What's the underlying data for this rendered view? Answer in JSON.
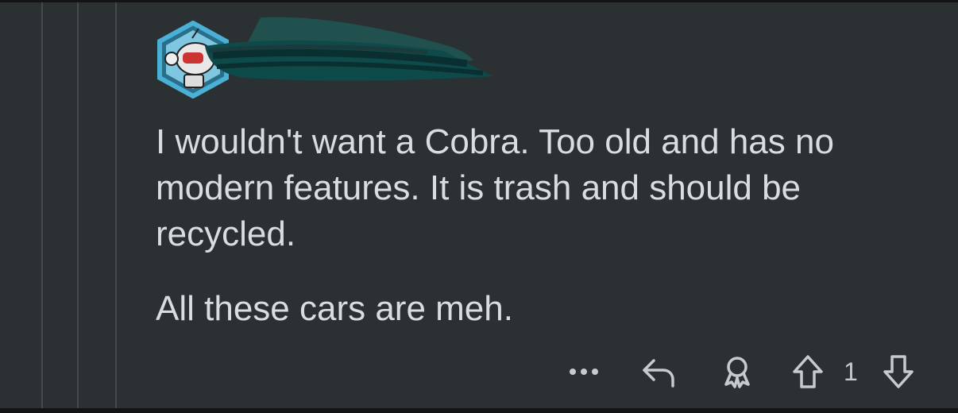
{
  "comment": {
    "paragraphs": [
      "I wouldn't want a Cobra. Too old and has no modern features. It is trash and should be recycled.",
      "All these cars are meh."
    ],
    "score": "1"
  },
  "actions": {
    "more_icon": "ellipsis-icon",
    "reply_icon": "reply-arrow-icon",
    "award_icon": "award-icon",
    "upvote_icon": "upvote-arrow-icon",
    "downvote_icon": "downvote-arrow-icon"
  },
  "colors": {
    "background": "#2b3033",
    "text": "#d9dde0",
    "icon": "#c6cbce",
    "thread_line": "#43494d",
    "avatar_ring": "#4ab0d6",
    "redaction": "#0f4a4a"
  }
}
